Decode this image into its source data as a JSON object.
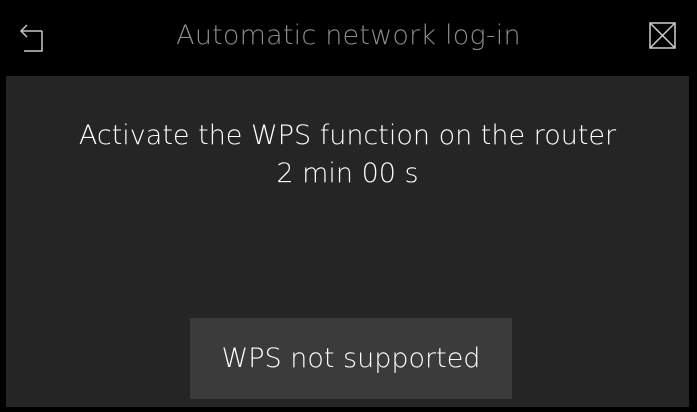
{
  "header": {
    "title": "Automatic network log-in",
    "back_icon": "back-arrow-icon",
    "close_icon": "close-icon"
  },
  "main": {
    "message": "Activate the WPS function on the router",
    "countdown": "2 min 00 s",
    "wps_button_label": "WPS not supported"
  },
  "colors": {
    "background": "#000000",
    "panel": "#252525",
    "button": "#3b3b3b",
    "title_text": "#8c8c8c",
    "text": "#ffffff"
  }
}
